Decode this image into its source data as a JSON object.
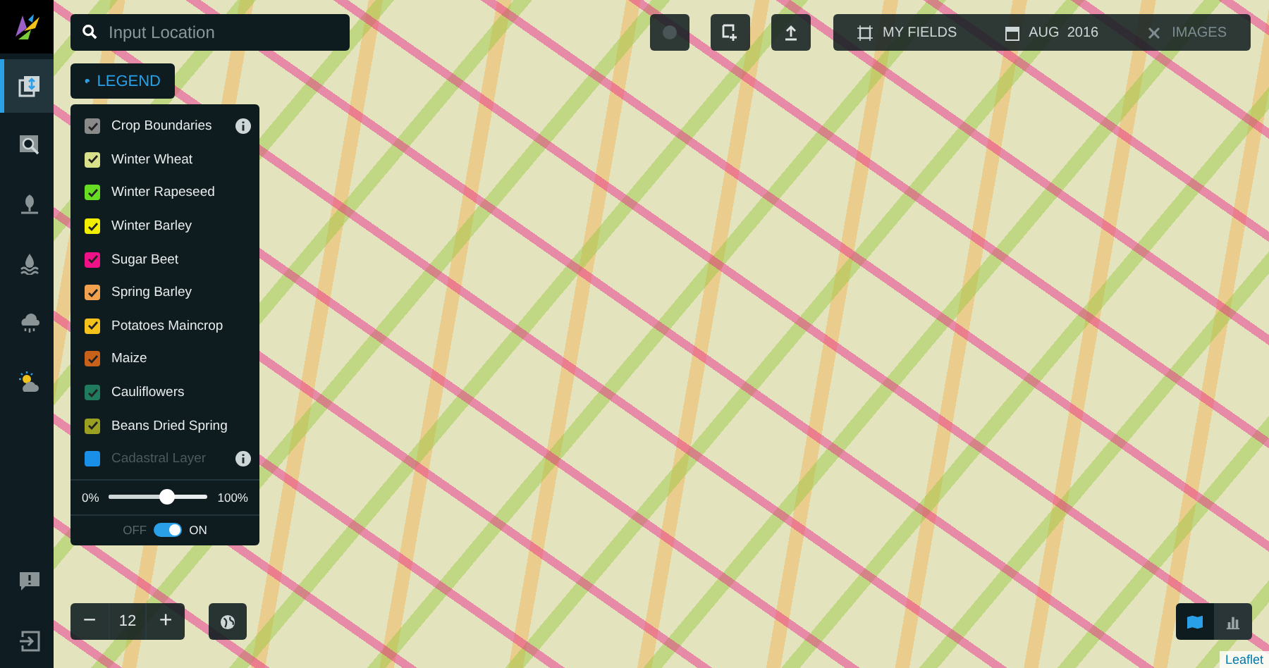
{
  "sidebar": {
    "items": [
      {
        "kind": "layers",
        "selected": true
      },
      {
        "kind": "search-map",
        "selected": false
      },
      {
        "kind": "crop",
        "selected": false
      },
      {
        "kind": "water",
        "selected": false
      },
      {
        "kind": "rain",
        "selected": false
      },
      {
        "kind": "sun",
        "selected": false
      }
    ],
    "bottom_items": [
      {
        "kind": "feedback"
      },
      {
        "kind": "logout"
      }
    ]
  },
  "search": {
    "placeholder": "Input Location"
  },
  "legend_button": {
    "label": "LEGEND"
  },
  "legend": {
    "layers": [
      {
        "label": "Crop Boundaries",
        "color": "#8a8a8a",
        "checked": true,
        "disabled": false,
        "has_info": true
      },
      {
        "label": "Winter Wheat",
        "color": "#d8e08a",
        "checked": true,
        "disabled": false,
        "has_info": false
      },
      {
        "label": "Winter Rapeseed",
        "color": "#66dd22",
        "checked": true,
        "disabled": false,
        "has_info": false
      },
      {
        "label": "Winter Barley",
        "color": "#f2ee00",
        "checked": true,
        "disabled": false,
        "has_info": false
      },
      {
        "label": "Sugar Beet",
        "color": "#ee1188",
        "checked": true,
        "disabled": false,
        "has_info": false
      },
      {
        "label": "Spring Barley",
        "color": "#f2a24e",
        "checked": true,
        "disabled": false,
        "has_info": false
      },
      {
        "label": "Potatoes Maincrop",
        "color": "#f4c21a",
        "checked": true,
        "disabled": false,
        "has_info": false
      },
      {
        "label": "Maize",
        "color": "#c8621a",
        "checked": true,
        "disabled": false,
        "has_info": false
      },
      {
        "label": "Cauliflowers",
        "color": "#1f7a5e",
        "checked": true,
        "disabled": false,
        "has_info": false
      },
      {
        "label": "Beans Dried Spring",
        "color": "#9aa020",
        "checked": true,
        "disabled": false,
        "has_info": false
      },
      {
        "label": "Cadastral Layer",
        "color": "#1a8fe8",
        "checked": false,
        "disabled": true,
        "has_info": true
      }
    ],
    "opacity": {
      "min_label": "0%",
      "max_label": "100%",
      "level": 0.6
    },
    "switch": {
      "off_label": "OFF",
      "on_label": "ON",
      "on": true
    }
  },
  "toolbar": {
    "my_fields": "MY FIELDS",
    "month": "AUG",
    "year": "2016",
    "images": {
      "label": "IMAGES",
      "disabled": true
    }
  },
  "zoom": {
    "minus": "−",
    "level": "12",
    "plus": "+"
  },
  "view_toggle": [
    {
      "kind": "map",
      "selected": true
    },
    {
      "kind": "chart",
      "selected": false
    }
  ],
  "attribution": "Leaflet"
}
